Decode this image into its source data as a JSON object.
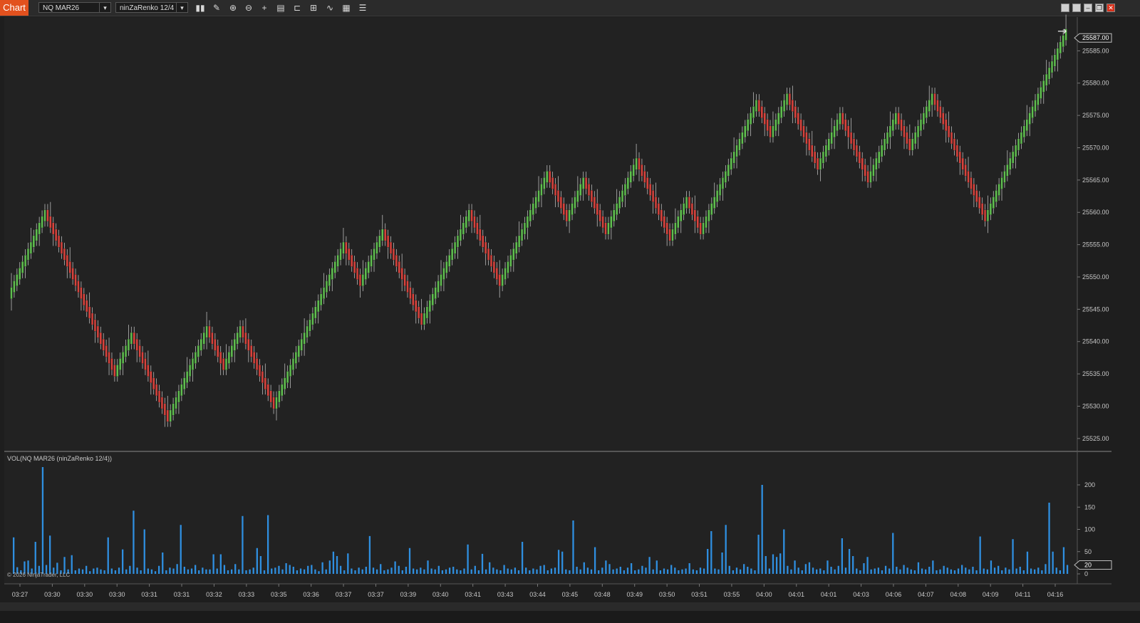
{
  "toolbar": {
    "chart_tab": "Chart",
    "instrument": "NQ MAR26",
    "bar_type": "ninZaRenko 12/4",
    "tools": [
      "bar-type-icon",
      "pencil-icon",
      "zoom-in-icon",
      "zoom-out-icon",
      "crosshair-icon",
      "data-box-icon",
      "template-icon",
      "properties-icon",
      "indicators-icon",
      "strategies-icon",
      "list-icon"
    ]
  },
  "price_panel": {
    "current_price": "25587.00",
    "price_ticks": [
      "25585.00",
      "25580.00",
      "25575.00",
      "25570.00",
      "25565.00",
      "25560.00",
      "25555.00",
      "25550.00",
      "25545.00",
      "25540.00",
      "25535.00",
      "25530.00",
      "25525.00"
    ]
  },
  "volume_panel": {
    "label": "VOL(NQ MAR26 (ninZaRenko 12/4))",
    "ticks": [
      "200",
      "150",
      "100",
      "50",
      "0"
    ],
    "current_volume": "20",
    "copyright": "© 2026 NinjaTrader, LLC"
  },
  "time_axis": [
    "03:27",
    "03:30",
    "03:30",
    "03:30",
    "03:31",
    "03:31",
    "03:32",
    "03:33",
    "03:35",
    "03:36",
    "03:37",
    "03:37",
    "03:39",
    "03:40",
    "03:41",
    "03:43",
    "03:44",
    "03:45",
    "03:48",
    "03:49",
    "03:50",
    "03:51",
    "03:55",
    "04:00",
    "04:01",
    "04:01",
    "04:03",
    "04:06",
    "04:07",
    "04:08",
    "04:09",
    "04:11",
    "04:16"
  ],
  "colors": {
    "up": "#5fbf4f",
    "down": "#d9423c",
    "volume": "#2f8fe0",
    "accent": "#e2511e"
  },
  "chart_data": {
    "type": "renko",
    "instrument": "NQ MAR26",
    "brick_type": "ninZaRenko 12/4",
    "ylim": [
      25523,
      25590
    ],
    "pivots": [
      25547,
      25560,
      25547,
      25535,
      25541,
      25528,
      25542,
      25536,
      25542,
      25530,
      25555,
      25549,
      25557,
      25543,
      25560,
      25549,
      25566,
      25559,
      25565,
      25557,
      25568,
      25556,
      25562,
      25557,
      25577,
      25572,
      25578,
      25567,
      25575,
      25565,
      25575,
      25570,
      25578,
      25559,
      25588
    ],
    "volume_ylim": [
      0,
      240
    ],
    "volume": [
      82,
      15,
      8,
      28,
      30,
      12,
      72,
      18,
      240,
      20,
      86,
      14,
      25,
      8,
      38,
      10,
      42,
      8,
      12,
      10,
      18,
      6,
      12,
      14,
      10,
      8,
      82,
      12,
      8,
      14,
      55,
      10,
      18,
      142,
      14,
      8,
      100,
      12,
      10,
      6,
      18,
      48,
      8,
      14,
      12,
      22,
      110,
      16,
      10,
      12,
      20,
      8,
      14,
      10,
      10,
      44,
      12,
      44,
      20,
      8,
      10,
      22,
      10,
      130,
      8,
      10,
      14,
      58,
      40,
      8,
      132,
      12,
      14,
      18,
      10,
      24,
      20,
      16,
      8,
      12,
      10,
      18,
      20,
      10,
      6,
      26,
      10,
      30,
      50,
      40,
      18,
      8,
      46,
      12,
      8,
      14,
      10,
      16,
      85,
      14,
      10,
      22,
      8,
      10,
      14,
      28,
      18,
      8,
      16,
      58,
      12,
      10,
      14,
      10,
      30,
      12,
      10,
      18,
      8,
      10,
      14,
      16,
      10,
      8,
      12,
      66,
      10,
      18,
      8,
      45,
      10,
      26,
      14,
      10,
      8,
      20,
      12,
      10,
      14,
      8,
      72,
      14,
      8,
      12,
      10,
      18,
      20,
      8,
      12,
      14,
      54,
      50,
      10,
      8,
      120,
      16,
      10,
      26,
      14,
      10,
      60,
      8,
      14,
      30,
      22,
      10,
      12,
      16,
      8,
      14,
      24,
      8,
      10,
      18,
      14,
      38,
      10,
      30,
      8,
      12,
      10,
      20,
      14,
      8,
      10,
      12,
      24,
      10,
      8,
      14,
      12,
      56,
      96,
      12,
      10,
      48,
      110,
      18,
      8,
      14,
      10,
      22,
      16,
      12,
      8,
      88,
      200,
      40,
      12,
      44,
      38,
      46,
      100,
      18,
      10,
      30,
      14,
      8,
      22,
      26,
      14,
      10,
      12,
      8,
      30,
      16,
      10,
      18,
      80,
      14,
      56,
      40,
      12,
      8,
      24,
      38,
      10,
      12,
      14,
      8,
      18,
      12,
      92,
      16,
      10,
      20,
      14,
      10,
      8,
      26,
      12,
      10,
      16,
      30,
      8,
      10,
      18,
      14,
      10,
      8,
      12,
      20,
      14,
      10,
      16,
      8,
      84,
      12,
      10,
      30,
      14,
      18,
      8,
      14,
      10,
      78,
      12,
      16,
      8,
      50,
      12,
      10,
      14,
      8,
      22,
      160,
      50,
      14,
      8,
      60,
      20
    ]
  }
}
